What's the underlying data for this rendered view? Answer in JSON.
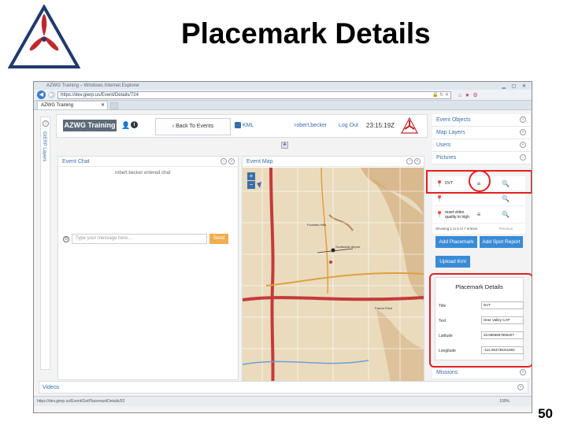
{
  "slide": {
    "title": "Placemark Details",
    "page_number": "50"
  },
  "browser": {
    "window_title": "AZWG Training – Windows Internet Explorer",
    "url": "https://dev.gierp.us/Event/Details/724",
    "tab_label": "AZWG Training",
    "status_url": "https://dev.gierp.us/Event/GetPlacemarkDetails/92",
    "zoom": "100%"
  },
  "app": {
    "brand": "AZWG Training",
    "back_label": "Back To Events",
    "kml_label": "KML",
    "user_name": "robert.becker",
    "logout_label": "Log Out",
    "clock": "23:15:19Z",
    "side_label": "GIERP Layers"
  },
  "chat": {
    "title": "Event Chat",
    "message": "robert.becker entered chat",
    "placeholder": "Type your message here...",
    "send_label": "Send"
  },
  "map": {
    "title": "Event Map",
    "labels": [
      "Fountain Hills",
      "Scottsdale Airport",
      "Falcon Field"
    ]
  },
  "sidebar": {
    "items": [
      {
        "label": "Event Objects",
        "icon": "info"
      },
      {
        "label": "Map Layers",
        "icon": "plus"
      },
      {
        "label": "Users",
        "icon": "plus"
      },
      {
        "label": "Pictures",
        "icon": "minus"
      }
    ],
    "pictures": [
      {
        "title": "DVT"
      },
      {
        "title": ""
      },
      {
        "title": "reset video quality to high"
      }
    ],
    "showing": "Showing 1 to 5 of 7 entries",
    "previous": "Previous",
    "add_placemark": "Add Placemark",
    "add_spot_report": "Add Spot Report",
    "upload_kml": "Upload Kml",
    "missions": "Missions"
  },
  "placemark": {
    "title": "Placemark Details",
    "fields": [
      {
        "label": "Title",
        "value": "DVT"
      },
      {
        "label": "Text",
        "value": "Deer Valley CAP"
      },
      {
        "label": "Latitude",
        "value": "33.6866667555407"
      },
      {
        "label": "Longitude",
        "value": "-112.064736311692"
      }
    ]
  },
  "videos": {
    "title": "Videos"
  },
  "colors": {
    "accent": "#3a6ea8",
    "highlight": "#e02020",
    "send": "#f0ad4e",
    "button": "#3a8bd6"
  }
}
